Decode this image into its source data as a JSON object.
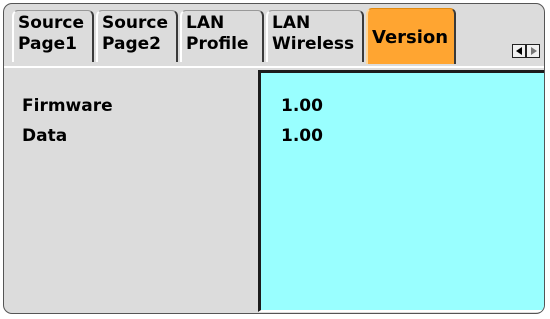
{
  "tabs": [
    {
      "line1": "Source",
      "line2": "Page1",
      "active": false
    },
    {
      "line1": "Source",
      "line2": "Page2",
      "active": false
    },
    {
      "line1": "LAN",
      "line2": "Profile",
      "active": false
    },
    {
      "line1": "LAN",
      "line2": "Wireless",
      "active": false
    },
    {
      "label": "Version",
      "active": true
    }
  ],
  "scroll": {
    "left_icon": "triangle-left-icon",
    "right_icon": "triangle-right-icon"
  },
  "version": {
    "rows": [
      {
        "label": "Firmware",
        "value": "1.00"
      },
      {
        "label": "Data",
        "value": "1.00"
      }
    ]
  },
  "colors": {
    "panel_bg": "#dcdcdc",
    "active_tab": "#ffa531",
    "value_box": "#99ffff"
  }
}
